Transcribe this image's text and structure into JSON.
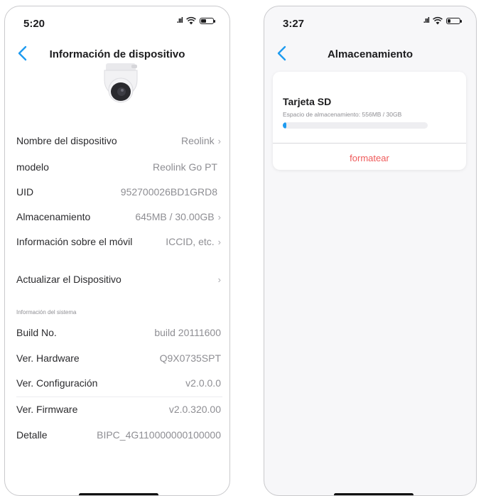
{
  "left": {
    "time": "5:20",
    "title": "Información de dispositivo",
    "rows": [
      {
        "label": "Nombre del dispositivo",
        "value": "Reolink",
        "chevron": "›"
      },
      {
        "label": "modelo",
        "value": "Reolink Go PT",
        "chevron": ""
      },
      {
        "label": "UID",
        "value": "952700026BD1GRD8",
        "chevron": ""
      },
      {
        "label": "Almacenamiento",
        "value": "645MB / 30.00GB",
        "chevron": "›"
      },
      {
        "label": "Información sobre el móvil",
        "value": "ICCID, etc.",
        "chevron": "›"
      },
      {
        "label": "Actualizar el Dispositivo",
        "value": "",
        "chevron": "›"
      }
    ],
    "section_label": "Información del sistema",
    "system_rows": [
      {
        "label": "Build No.",
        "value": "build 20111600"
      },
      {
        "label": "Ver. Hardware",
        "value": "Q9X0735SPT"
      },
      {
        "label": "Ver. Configuración",
        "value": "v2.0.0.0"
      },
      {
        "label": "Ver. Firmware",
        "value": "v2.0.320.00"
      },
      {
        "label": "Detalle",
        "value": "BIPC_4G110000000100000"
      }
    ]
  },
  "right": {
    "time": "3:27",
    "title": "Almacenamiento",
    "card_title": "Tarjeta SD",
    "card_subtitle": "Espacio de almacenamiento: 556MB / 30GB",
    "usage_fraction": 0.018,
    "format_label": "formatear"
  },
  "colors": {
    "accent": "#1e9bf0",
    "danger": "#ef5a5a",
    "muted": "#8e8e93"
  },
  "icons": {
    "back": "chevron-left-icon",
    "signal": "signal-icon",
    "wifi": "wifi-icon",
    "battery": "battery-icon"
  }
}
